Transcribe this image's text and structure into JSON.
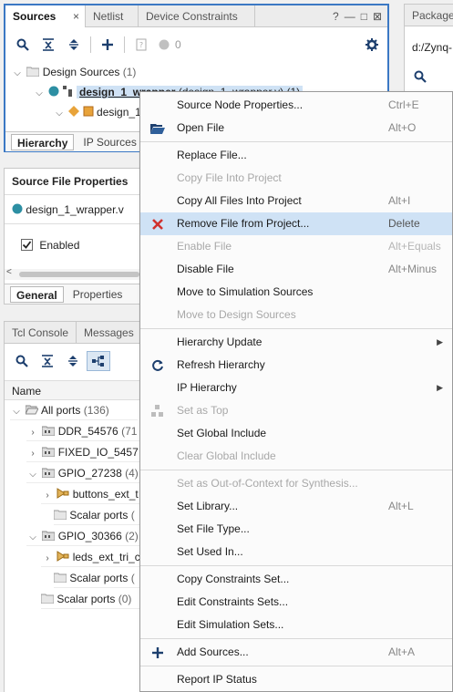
{
  "sources_panel": {
    "tabs": [
      "Sources",
      "Netlist",
      "Device Constraints"
    ],
    "close_glyph": "×",
    "window_buttons": [
      "?",
      "—",
      "□",
      "⊠"
    ],
    "toolbar_count": "0",
    "tree": {
      "root_label": "Design Sources",
      "root_count": "(1)",
      "wrapper_label": "design_1_wrapper",
      "wrapper_rest": " (design_1_wrapper.v) (1)",
      "child_label": "design_1"
    },
    "bottom_tabs": [
      "Hierarchy",
      "IP Sources"
    ]
  },
  "package_panel": {
    "tab": "Package",
    "path": "d:/Zynq-"
  },
  "properties_panel": {
    "title": "Source File Properties",
    "file_name": "design_1_wrapper.v",
    "enabled_label": "Enabled",
    "tabs": [
      "General",
      "Properties"
    ]
  },
  "console_panel": {
    "tabs": [
      "Tcl Console",
      "Messages"
    ],
    "column_header": "Name",
    "rows": [
      {
        "label": "All ports",
        "count": "(136)"
      },
      {
        "label": "DDR_54576",
        "count": "(71"
      },
      {
        "label": "FIXED_IO_5457",
        "count": ""
      },
      {
        "label": "GPIO_27238",
        "count": "(4)"
      },
      {
        "label": "buttons_ext_t",
        "count": ""
      },
      {
        "label": "Scalar ports",
        "count": "("
      },
      {
        "label": "GPIO_30366",
        "count": "(2)"
      },
      {
        "label": "leds_ext_tri_c",
        "count": ""
      },
      {
        "label": "Scalar ports",
        "count": "("
      },
      {
        "label": "Scalar ports",
        "count": "(0)"
      }
    ]
  },
  "context_menu": {
    "items": [
      {
        "label": "Source Node Properties...",
        "shortcut": "Ctrl+E"
      },
      {
        "label": "Open File",
        "shortcut": "Alt+O"
      },
      {
        "label": "Replace File...",
        "shortcut": ""
      },
      {
        "label": "Copy File Into Project",
        "shortcut": ""
      },
      {
        "label": "Copy All Files Into Project",
        "shortcut": "Alt+I"
      },
      {
        "label": "Remove File from Project...",
        "shortcut": "Delete"
      },
      {
        "label": "Enable File",
        "shortcut": "Alt+Equals"
      },
      {
        "label": "Disable File",
        "shortcut": "Alt+Minus"
      },
      {
        "label": "Move to Simulation Sources",
        "shortcut": ""
      },
      {
        "label": "Move to Design Sources",
        "shortcut": ""
      },
      {
        "label": "Hierarchy Update",
        "shortcut": ""
      },
      {
        "label": "Refresh Hierarchy",
        "shortcut": ""
      },
      {
        "label": "IP Hierarchy",
        "shortcut": ""
      },
      {
        "label": "Set as Top",
        "shortcut": ""
      },
      {
        "label": "Set Global Include",
        "shortcut": ""
      },
      {
        "label": "Clear Global Include",
        "shortcut": ""
      },
      {
        "label": "Set as Out-of-Context for Synthesis...",
        "shortcut": ""
      },
      {
        "label": "Set Library...",
        "shortcut": "Alt+L"
      },
      {
        "label": "Set File Type...",
        "shortcut": ""
      },
      {
        "label": "Set Used In...",
        "shortcut": ""
      },
      {
        "label": "Copy Constraints Set...",
        "shortcut": ""
      },
      {
        "label": "Edit Constraints Sets...",
        "shortcut": ""
      },
      {
        "label": "Edit Simulation Sets...",
        "shortcut": ""
      },
      {
        "label": "Add Sources...",
        "shortcut": "Alt+A"
      },
      {
        "label": "Report IP Status",
        "shortcut": ""
      }
    ]
  },
  "colors": {
    "accent_blue": "#3b78c4",
    "highlight": "#cfe2f5",
    "remove_red": "#d0312d",
    "status_teal": "#2d8fa3"
  }
}
